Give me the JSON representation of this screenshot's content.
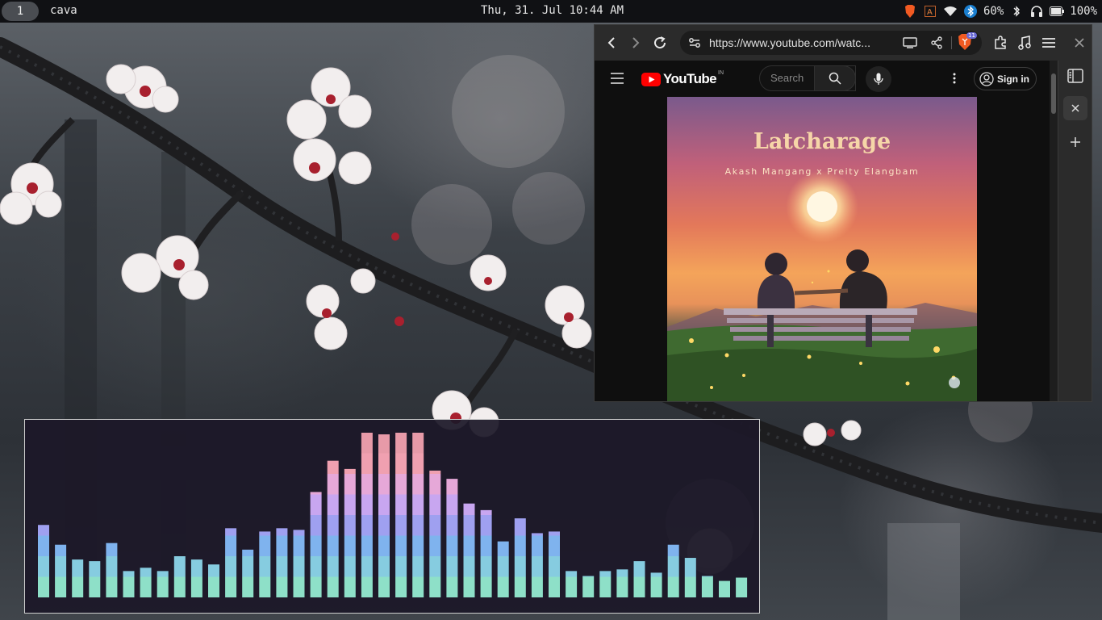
{
  "topbar": {
    "workspace": "1",
    "window_title": "cava",
    "clock": "Thu, 31. Jul  10:44 AM",
    "tray": {
      "icons": [
        "brave-icon",
        "font-icon",
        "wifi-icon",
        "bluetooth-icon"
      ],
      "volume": "60%",
      "battery": "100%"
    }
  },
  "browser": {
    "url": "https://www.youtube.com/watc...",
    "shield_badge": "11",
    "toolbar_icons": [
      "back-icon",
      "forward-icon",
      "reload-icon",
      "site-settings-icon",
      "cast-icon",
      "share-icon",
      "brave-shield-icon",
      "extensions-icon",
      "media-icon",
      "menu-icon",
      "close-icon"
    ],
    "sidebar_icons": [
      "sidebar-panel-icon",
      "close-icon",
      "add-icon"
    ],
    "youtube": {
      "logo_text": "YouTube",
      "country": "IN",
      "search_placeholder": "Search",
      "signin_label": "Sign in"
    },
    "video": {
      "title": "Latcharage",
      "artist": "Akash Mangang x Preity Elangbam"
    }
  },
  "cava": {
    "levels": [
      0.44,
      0.32,
      0.23,
      0.22,
      0.33,
      0.16,
      0.18,
      0.16,
      0.25,
      0.23,
      0.2,
      0.42,
      0.29,
      0.4,
      0.42,
      0.41,
      0.64,
      0.83,
      0.78,
      1.0,
      0.99,
      1.0,
      1.0,
      0.77,
      0.72,
      0.57,
      0.53,
      0.34,
      0.48,
      0.39,
      0.4,
      0.16,
      0.13,
      0.16,
      0.17,
      0.22,
      0.15,
      0.32,
      0.24,
      0.13,
      0.1,
      0.12
    ],
    "colors": [
      "#8ee0c8",
      "#86cce0",
      "#7fb3ee",
      "#9fa0f0",
      "#c8a6f0",
      "#e6a8d8",
      "#f0a0b0",
      "#e79aa8"
    ]
  }
}
